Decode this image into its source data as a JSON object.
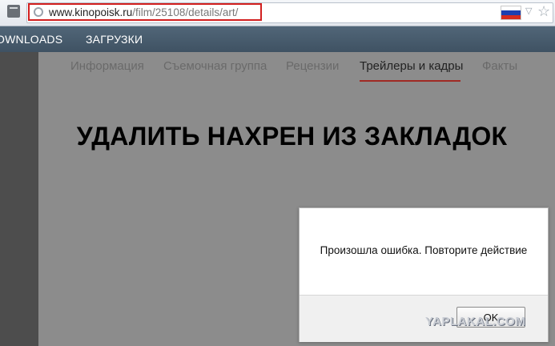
{
  "browser": {
    "url_host": "www.kinopoisk.ru",
    "url_path": "/film/25108/details/art/",
    "flag_colors": [
      "#ffffff",
      "#1c3fb0",
      "#d52b1e"
    ]
  },
  "bookmarks": [
    "OWNLOADS",
    "ЗАГРУЗКИ"
  ],
  "tabs": [
    {
      "label": "Информация",
      "active": false
    },
    {
      "label": "Съемочная группа",
      "active": false
    },
    {
      "label": "Рецензии",
      "active": false
    },
    {
      "label": "Трейлеры и кадры",
      "active": true
    },
    {
      "label": "Факты",
      "active": false
    }
  ],
  "overlay_text": "УДАЛИТЬ НАХРЕН ИЗ ЗАКЛАДОК",
  "dialog": {
    "message": "Произошла ошибка. Повторите действие",
    "ok_label": "OK"
  },
  "watermark": "YAPLAKAL.COM"
}
